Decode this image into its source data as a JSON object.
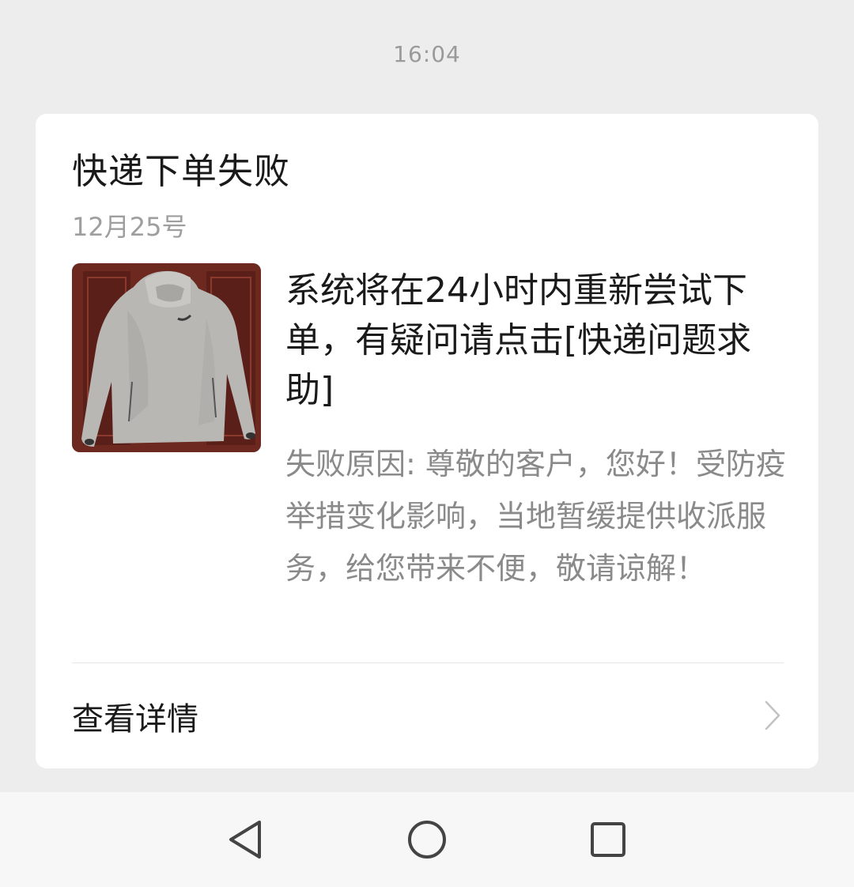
{
  "chat": {
    "timestamp": "16:04"
  },
  "card": {
    "title": "快递下单失败",
    "date": "12月25号",
    "thumbnail_icon": "hoodie-photo",
    "headline": "系统将在24小时内重新尝试下单，有疑问请点击[快递问题求助]",
    "description": "失败原因: 尊敬的客户，您好！受防疫举措变化影响，当地暂缓提供收派服务，给您带来不便，敬请谅解！",
    "detail_label": "查看详情",
    "detail_icon": "chevron-right-icon"
  },
  "navbar": {
    "back_icon": "back-triangle-icon",
    "home_icon": "home-circle-icon",
    "recent_icon": "recent-square-icon"
  },
  "colors": {
    "background": "#ededed",
    "card": "#ffffff",
    "primary_text": "#1a1a1a",
    "secondary_text": "#9e9e9e",
    "navbar": "#f7f7f7"
  }
}
